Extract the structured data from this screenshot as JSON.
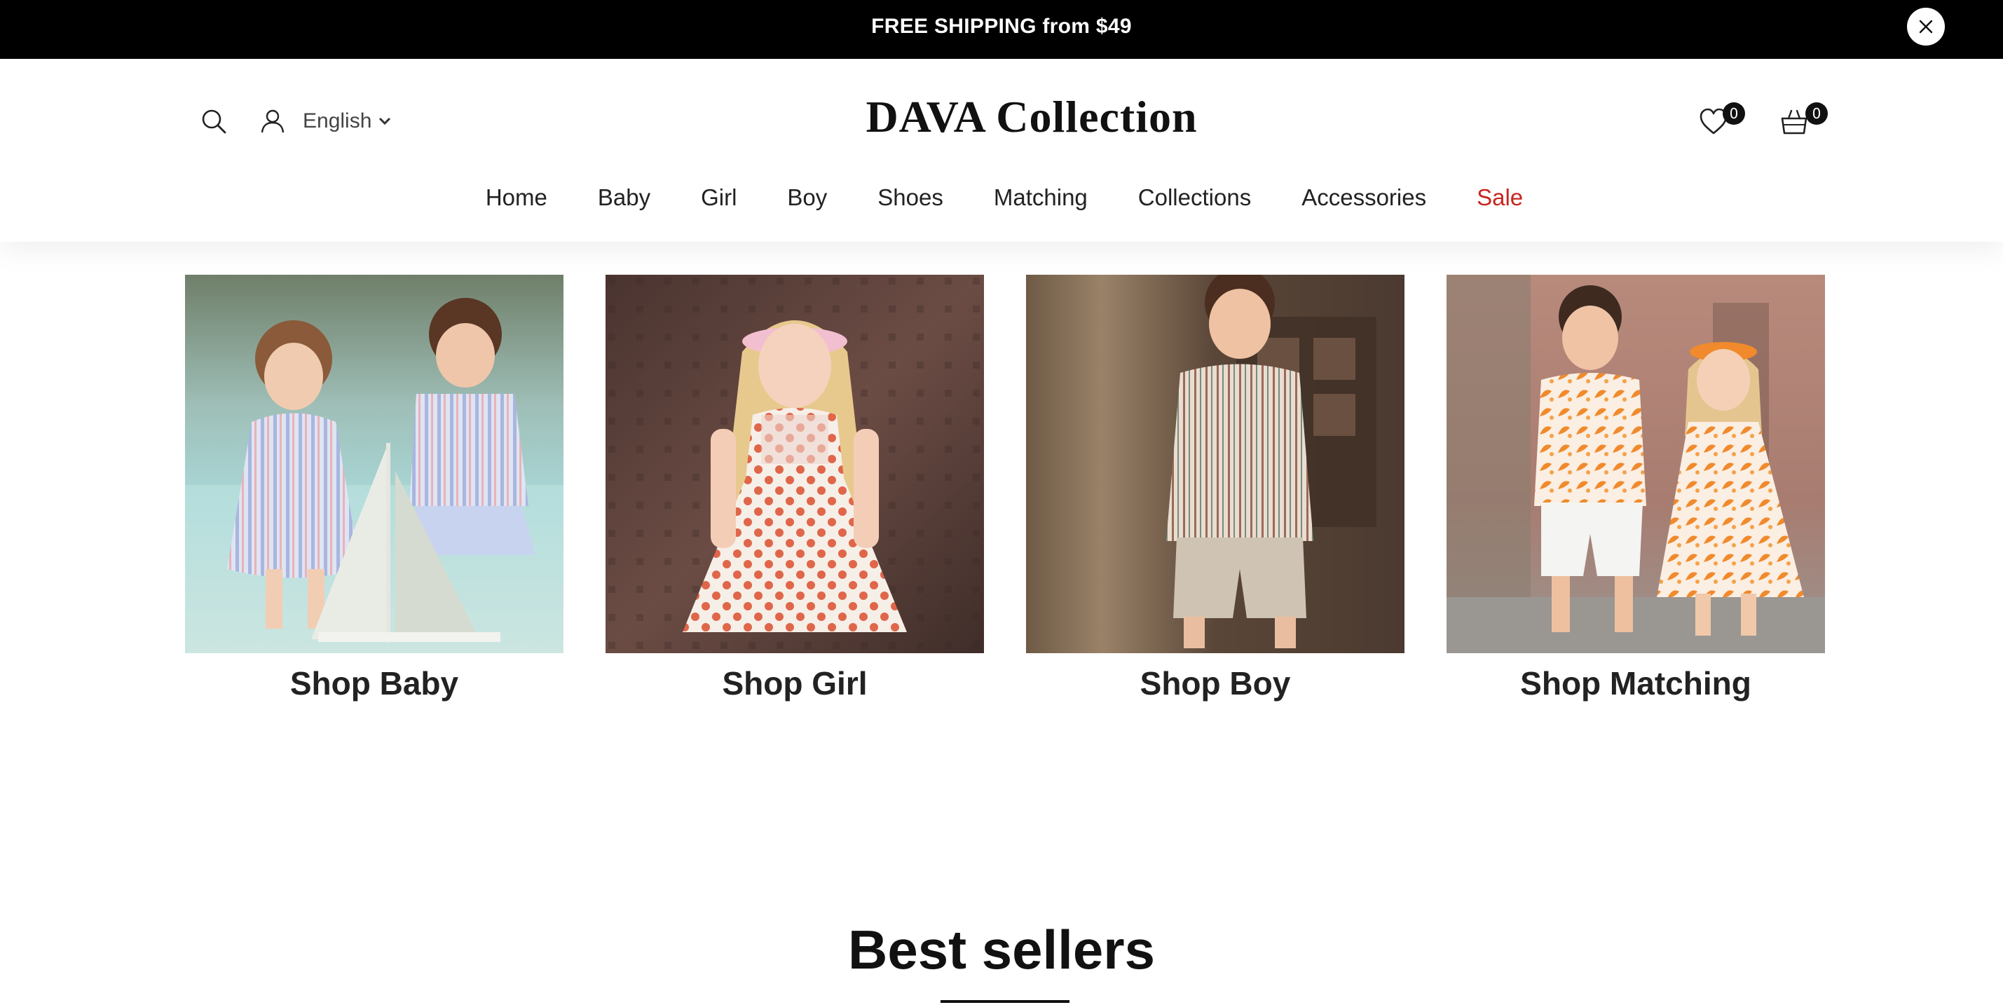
{
  "announcement": {
    "text": "FREE SHIPPING from $49",
    "close_icon": "close-icon"
  },
  "header": {
    "logo": "DAVA Collection",
    "language": "English",
    "icons": {
      "search": "search-icon",
      "account": "user-icon",
      "language_caret": "chevron-down-icon",
      "wishlist": "heart-icon",
      "cart": "basket-icon"
    },
    "wishlist_count": "0",
    "cart_count": "0"
  },
  "nav": {
    "items": [
      "Home",
      "Baby",
      "Girl",
      "Boy",
      "Shoes",
      "Matching",
      "Collections",
      "Accessories",
      "Sale"
    ],
    "sale_color": "#c8251d"
  },
  "categories": [
    {
      "label": "Shop Baby"
    },
    {
      "label": "Shop Girl"
    },
    {
      "label": "Shop Boy"
    },
    {
      "label": "Shop Matching"
    }
  ],
  "best_sellers": {
    "title": "Best sellers"
  },
  "colors": {
    "announcement_bg": "#000000",
    "text": "#111111",
    "sale": "#c8251d"
  }
}
